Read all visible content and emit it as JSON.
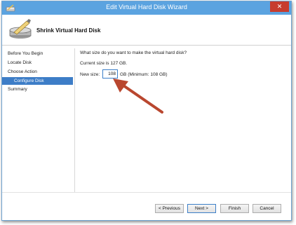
{
  "window": {
    "title": "Edit Virtual Hard Disk Wizard",
    "close_label": "✕"
  },
  "header": {
    "title": "Shrink Virtual Hard Disk"
  },
  "sidebar": {
    "items": [
      {
        "label": "Before You Begin"
      },
      {
        "label": "Locate Disk"
      },
      {
        "label": "Choose Action"
      },
      {
        "label": "Configure Disk",
        "selected": true
      },
      {
        "label": "Summary"
      }
    ]
  },
  "main": {
    "question": "What size do you want to make the virtual hard disk?",
    "current_size": "Current size is 127 GB.",
    "new_size_label": "New size:",
    "new_size_value": "108",
    "unit_hint": "GB (Minimum: 108 GB)"
  },
  "buttons": {
    "previous": "< Previous",
    "next": "Next >",
    "finish": "Finish",
    "cancel": "Cancel"
  },
  "colors": {
    "titlebar": "#5ba3e0",
    "selection": "#3d7dc7",
    "close": "#c73c2e",
    "annotation_arrow": "#b9472f"
  },
  "icons": {
    "title": "disk-wizard-icon",
    "header": "disk-wrench-icon",
    "annotation": "red-arrow-annotation"
  }
}
